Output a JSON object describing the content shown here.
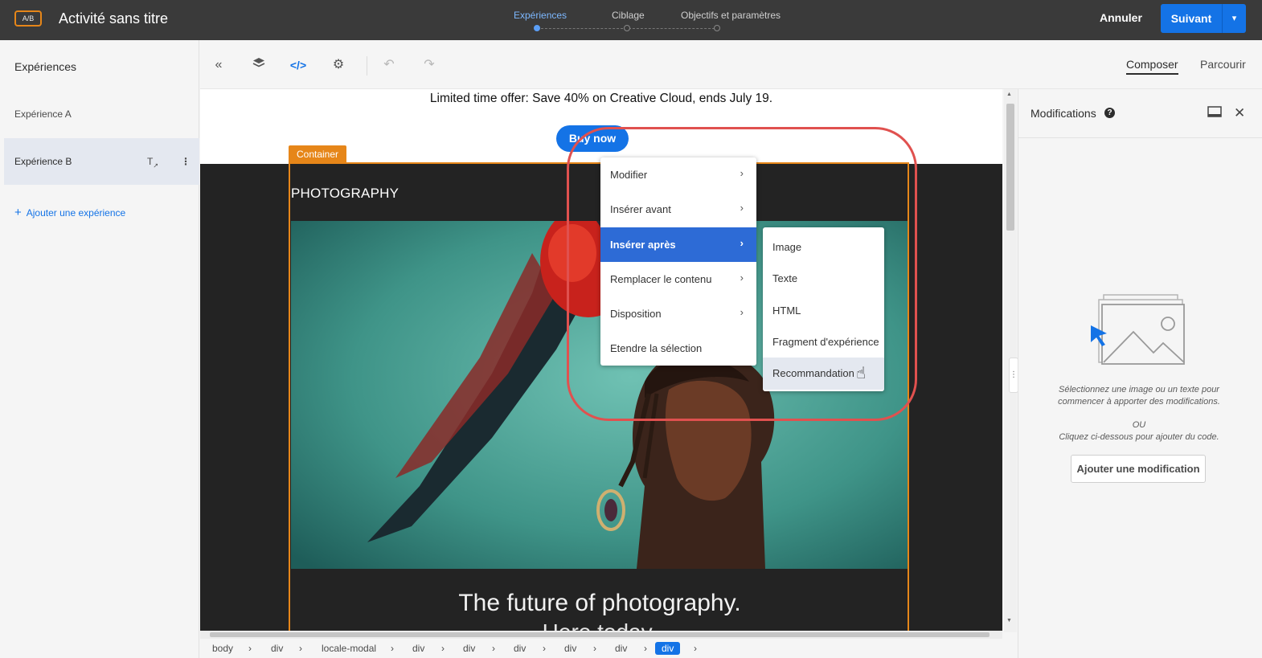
{
  "topbar": {
    "badge": "A/B",
    "title": "Activité sans titre",
    "steps": [
      "Expériences",
      "Ciblage",
      "Objectifs et paramètres"
    ],
    "cancel": "Annuler",
    "next": "Suivant"
  },
  "sidebar": {
    "title": "Expériences",
    "items": [
      {
        "label": "Expérience A"
      },
      {
        "label": "Expérience B"
      }
    ],
    "add_label": "Ajouter une expérience"
  },
  "toolbar": {
    "tabs": [
      "Composer",
      "Parcourir"
    ]
  },
  "canvas": {
    "promo_text": "Limited time offer: Save 40% on Creative Cloud, ends July 19.",
    "buy_button": "Buy now",
    "container_tag": "Container",
    "section_label": "PHOTOGRAPHY",
    "headline": "The future of photography.",
    "headline2": "Here today."
  },
  "context_menu": {
    "items": [
      {
        "label": "Modifier"
      },
      {
        "label": "Insérer avant"
      },
      {
        "label": "Insérer après"
      },
      {
        "label": "Remplacer le contenu"
      },
      {
        "label": "Disposition"
      },
      {
        "label": "Etendre la sélection"
      }
    ],
    "submenu": [
      {
        "label": "Image"
      },
      {
        "label": "Texte"
      },
      {
        "label": "HTML"
      },
      {
        "label": "Fragment d'expérience"
      },
      {
        "label": "Recommandation"
      }
    ]
  },
  "breadcrumbs": [
    "body",
    "div",
    "locale-modal",
    "div",
    "div",
    "div",
    "div",
    "div",
    "div"
  ],
  "right_panel": {
    "title": "Modifications",
    "hint": "Sélectionnez une image ou un texte pour commencer à apporter des modifications.",
    "or": "OU",
    "hint2": "Cliquez ci-dessous pour ajouter du code.",
    "add_button": "Ajouter une modification"
  },
  "colors": {
    "accent": "#1473e6",
    "container_orange": "#e68619",
    "highlight_red": "#e0514f",
    "topbar": "#3a3a3a"
  }
}
